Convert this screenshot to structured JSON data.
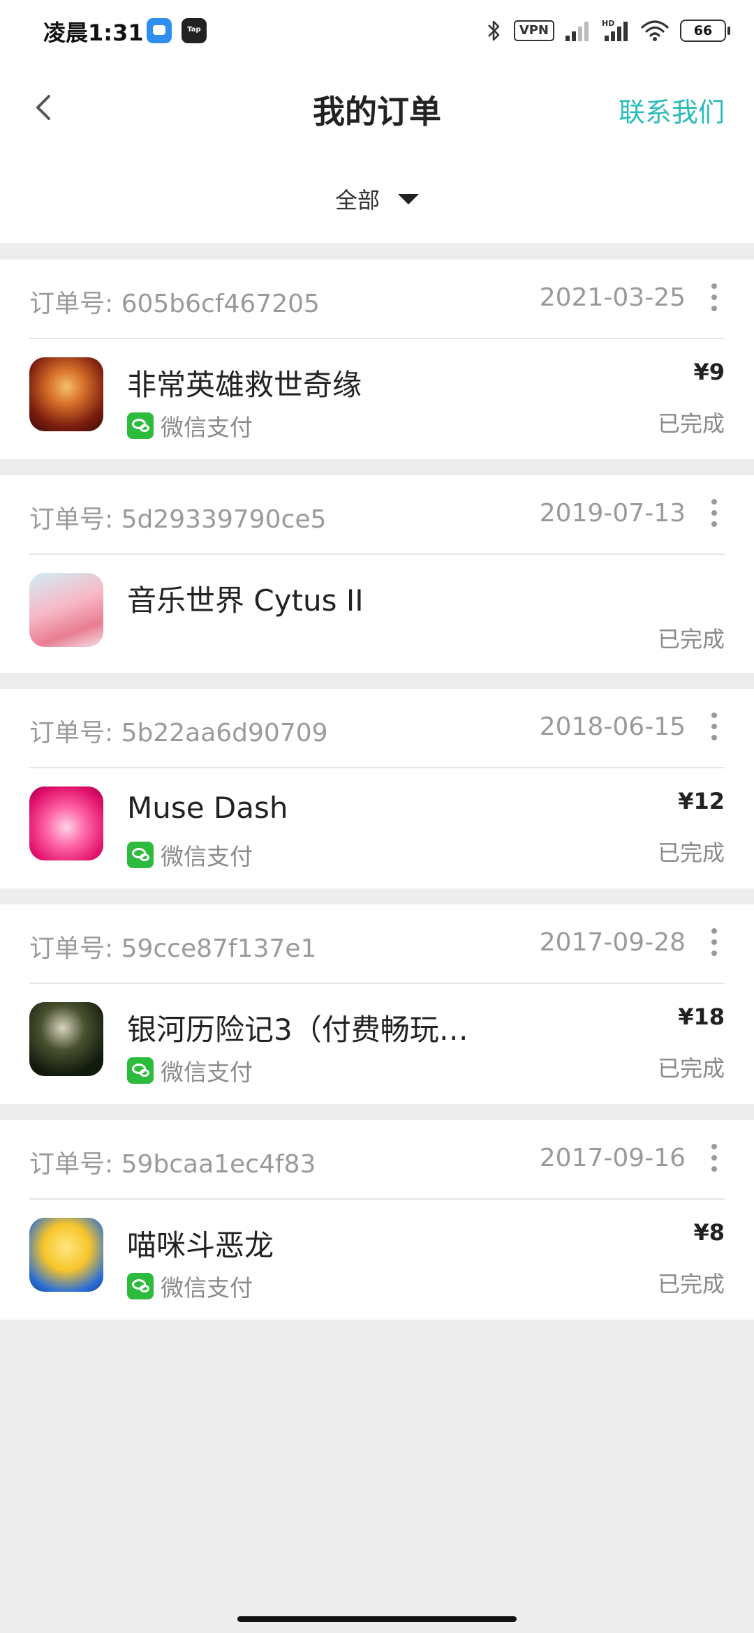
{
  "status_bar": {
    "time": "凌晨1:31",
    "tap_icon_text": "Tap",
    "vpn": "VPN",
    "battery": "66",
    "icons": [
      "notification-app-icon",
      "taptap-icon",
      "bluetooth-icon",
      "vpn-icon",
      "signal-icon",
      "hd-signal-icon",
      "wifi-icon",
      "battery-icon"
    ]
  },
  "header": {
    "title": "我的订单",
    "contact": "联系我们",
    "back_icon": "chevron-left-icon"
  },
  "filter": {
    "selected": "全部",
    "icon": "caret-down-icon"
  },
  "colors": {
    "accent": "#2bbcba",
    "wechat_green": "#2dbb3d",
    "background": "#ededed",
    "muted_text": "#9a9a9a"
  },
  "orders": [
    {
      "order_prefix": "订单号: ",
      "order_no": "605b6cf467205",
      "date": "2021-03-25",
      "app_name": "非常英雄救世奇缘",
      "payment": "微信支付",
      "price": "¥9",
      "status": "已完成"
    },
    {
      "order_prefix": "订单号: ",
      "order_no": "5d29339790ce5",
      "date": "2019-07-13",
      "app_name": "音乐世界 Cytus II",
      "payment": "",
      "price": "",
      "status": "已完成"
    },
    {
      "order_prefix": "订单号: ",
      "order_no": "5b22aa6d90709",
      "date": "2018-06-15",
      "app_name": "Muse Dash",
      "payment": "微信支付",
      "price": "¥12",
      "status": "已完成"
    },
    {
      "order_prefix": "订单号: ",
      "order_no": "59cce87f137e1",
      "date": "2017-09-28",
      "app_name": "银河历险记3（付费畅玩…",
      "payment": "微信支付",
      "price": "¥18",
      "status": "已完成"
    },
    {
      "order_prefix": "订单号: ",
      "order_no": "59bcaa1ec4f83",
      "date": "2017-09-16",
      "app_name": "喵咪斗恶龙",
      "payment": "微信支付",
      "price": "¥8",
      "status": "已完成"
    }
  ]
}
